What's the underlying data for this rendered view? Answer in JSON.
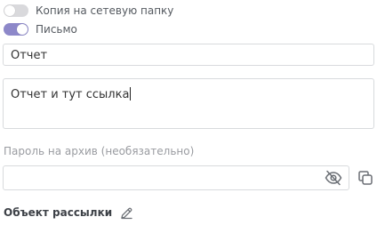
{
  "toggles": [
    {
      "label": "Копия на сетевую папку",
      "on": false
    },
    {
      "label": "Письмо",
      "on": true
    }
  ],
  "subject": {
    "value": "Отчет"
  },
  "body": {
    "value": "Отчет и тут ссылка"
  },
  "archive_password": {
    "label": "Пароль на архив (необязательно)",
    "value": ""
  },
  "mailing_object": {
    "title": "Объект рассылки"
  },
  "icons": {
    "visibility": "eye-off-icon",
    "copy": "copy-icon",
    "edit": "pencil-icon"
  },
  "colors": {
    "toggle_on": "#8d88c9",
    "toggle_off": "#d9d9dc"
  }
}
